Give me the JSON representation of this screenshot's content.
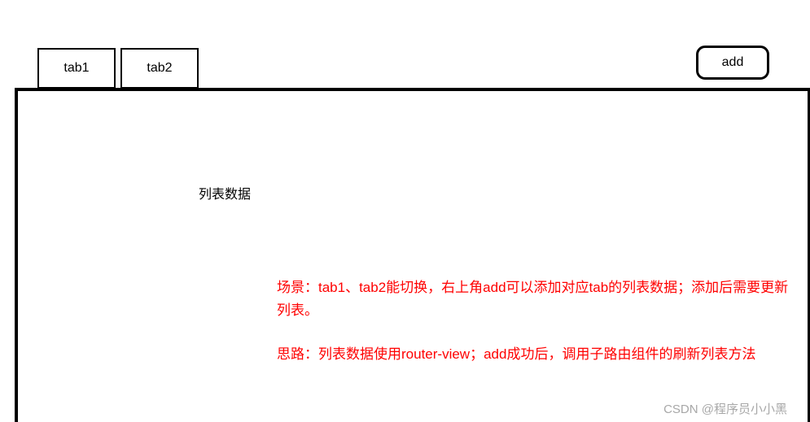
{
  "tabs": [
    "tab1",
    "tab2"
  ],
  "addButton": "add",
  "panel": {
    "listLabel": "列表数据",
    "scenario": "场景：tab1、tab2能切换，右上角add可以添加对应tab的列表数据；添加后需要更新列表。",
    "idea": "思路：列表数据使用router-view；add成功后，调用子路由组件的刷新列表方法"
  },
  "watermark": "CSDN @程序员小小黑"
}
